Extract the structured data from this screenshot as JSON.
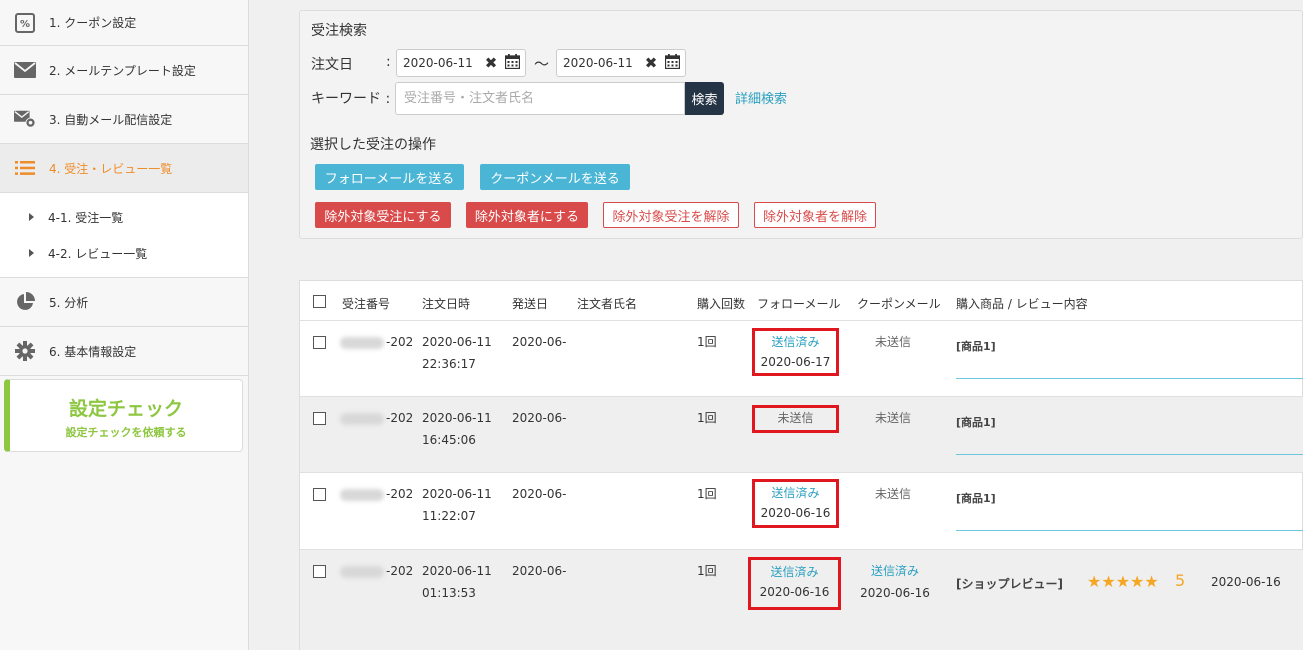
{
  "sidebar": {
    "items": [
      {
        "label": "1. クーポン設定",
        "icon": "coupon-icon"
      },
      {
        "label": "2. メールテンプレート設定",
        "icon": "mail-icon"
      },
      {
        "label": "3. 自動メール配信設定",
        "icon": "mail-gear-icon"
      },
      {
        "label": "4. 受注・レビュー一覧",
        "icon": "list-icon",
        "active": true
      },
      {
        "label": "5. 分析",
        "icon": "pie-chart-icon"
      },
      {
        "label": "6. 基本情報設定",
        "icon": "gear-icon"
      }
    ],
    "sub_items": [
      {
        "label": "4-1. 受注一覧"
      },
      {
        "label": "4-2. レビュー一覧"
      }
    ],
    "check_card": {
      "title": "設定チェック",
      "subtitle": "設定チェックを依頼する"
    }
  },
  "search": {
    "title": "受注検索",
    "order_date_label": "注文日",
    "colon": ":",
    "date_from": "2020-06-11",
    "date_to": "2020-06-11",
    "tilde": "〜",
    "keyword_label": "キーワード :",
    "keyword_placeholder": "受注番号・注文者氏名",
    "search_button": "検索",
    "advanced_link": "詳細検索"
  },
  "operations": {
    "title": "選択した受注の操作",
    "follow_mail": "フォローメールを送る",
    "coupon_mail": "クーポンメールを送る",
    "exclude_order": "除外対象受注にする",
    "exclude_customer": "除外対象者にする",
    "unexclude_order": "除外対象受注を解除",
    "unexclude_customer": "除外対象者を解除"
  },
  "table": {
    "headers": {
      "order_no": "受注番号",
      "order_date": "注文日時",
      "ship_date": "発送日",
      "customer": "注文者氏名",
      "count": "購入回数",
      "follow": "フォローメール",
      "coupon": "クーポンメール",
      "product": "購入商品 / レビュー内容"
    },
    "rows": [
      {
        "order_suffix": "-202",
        "date": "2020-06-11",
        "time": "22:36:17",
        "ship": "2020-06-",
        "count": "1回",
        "follow_status": "送信済み",
        "follow_date": "2020-06-17",
        "coupon_status": "未送信",
        "coupon_date": "",
        "product": "[商品1]"
      },
      {
        "order_suffix": "-202",
        "date": "2020-06-11",
        "time": "16:45:06",
        "ship": "2020-06-",
        "count": "1回",
        "follow_status": "未送信",
        "follow_date": "",
        "coupon_status": "未送信",
        "coupon_date": "",
        "product": "[商品1]"
      },
      {
        "order_suffix": "-202",
        "date": "2020-06-11",
        "time": "11:22:07",
        "ship": "2020-06-",
        "count": "1回",
        "follow_status": "送信済み",
        "follow_date": "2020-06-16",
        "coupon_status": "未送信",
        "coupon_date": "",
        "product": "[商品1]"
      },
      {
        "order_suffix": "-202",
        "date": "2020-06-11",
        "time": "01:13:53",
        "ship": "2020-06-",
        "count": "1回",
        "follow_status": "送信済み",
        "follow_date": "2020-06-16",
        "coupon_status": "送信済み",
        "coupon_date": "2020-06-16",
        "product": "[ショップレビュー]",
        "stars": "★★★★★",
        "rating": "5",
        "review_date": "2020-06-16"
      }
    ]
  },
  "colors": {
    "accent": "#f08c28",
    "link": "#2aa0c0",
    "danger": "#d94b4b",
    "info": "#4bb5d6",
    "green": "#8dc63f",
    "highlight": "#e0171e"
  }
}
